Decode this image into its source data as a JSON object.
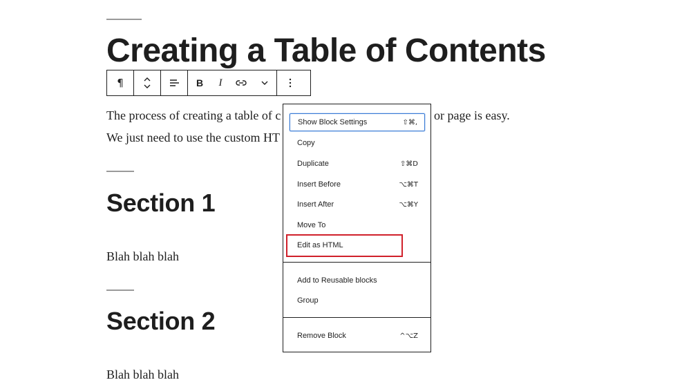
{
  "document": {
    "title": "Creating a Table of Contents",
    "paragraph_line1_start": "The process of creating a table of c",
    "paragraph_line1_end": "or page is easy.",
    "paragraph_line2": "We just need to use the custom HT",
    "sections": [
      {
        "heading": "Section 1",
        "body": "Blah blah blah"
      },
      {
        "heading": "Section 2",
        "body": "Blah blah blah"
      }
    ]
  },
  "toolbar": {
    "paragraph_icon": "¶",
    "bold_label": "B",
    "italic_label": "I"
  },
  "menu": {
    "items": [
      {
        "label": "Show Block Settings",
        "shortcut": "⇧⌘,"
      },
      {
        "label": "Copy",
        "shortcut": ""
      },
      {
        "label": "Duplicate",
        "shortcut": "⇧⌘D"
      },
      {
        "label": "Insert Before",
        "shortcut": "⌥⌘T"
      },
      {
        "label": "Insert After",
        "shortcut": "⌥⌘Y"
      },
      {
        "label": "Move To",
        "shortcut": ""
      },
      {
        "label": "Edit as HTML",
        "shortcut": ""
      }
    ],
    "reusable_items": [
      {
        "label": "Add to Reusable blocks"
      },
      {
        "label": "Group"
      }
    ],
    "remove_item": {
      "label": "Remove Block",
      "shortcut": "^⌥Z"
    }
  },
  "colors": {
    "text": "#1e1e1e",
    "focus_outline": "#3a7bd5",
    "highlight_box": "#d0202a"
  }
}
